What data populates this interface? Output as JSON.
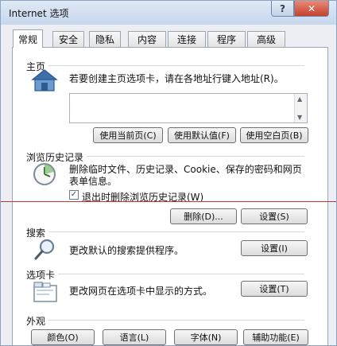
{
  "window": {
    "title": "Internet 选项",
    "help_label": "?",
    "close_label": "✕"
  },
  "tabs": [
    {
      "label": "常规",
      "active": true
    },
    {
      "label": "安全",
      "active": false
    },
    {
      "label": "隐私",
      "active": false
    },
    {
      "label": "内容",
      "active": false
    },
    {
      "label": "连接",
      "active": false
    },
    {
      "label": "程序",
      "active": false
    },
    {
      "label": "高级",
      "active": false
    }
  ],
  "home": {
    "group_label": "主页",
    "description": "若要创建主页选项卡，请在各地址行键入地址(R)。",
    "address_value": "",
    "use_current_label": "使用当前页(C)",
    "use_default_label": "使用默认值(F)",
    "use_blank_label": "使用空白页(B)"
  },
  "history": {
    "group_label": "浏览历史记录",
    "description_line1": "删除临时文件、历史记录、Cookie、保存的密码和网页",
    "description_line2": "表单信息。",
    "checkbox_label": "退出时删除浏览历史记录(W)",
    "checkbox_checked": true,
    "delete_label": "删除(D)...",
    "settings_label": "设置(S)"
  },
  "search": {
    "group_label": "搜索",
    "description": "更改默认的搜索提供程序。",
    "settings_label": "设置(I)"
  },
  "tabs_section": {
    "group_label": "选项卡",
    "description": "更改网页在选项卡中显示的方式。",
    "settings_label": "设置(T)"
  },
  "appearance": {
    "group_label": "外观",
    "colors_label": "颜色(O)",
    "languages_label": "语言(L)",
    "fonts_label": "字体(N)",
    "accessibility_label": "辅助功能(E)"
  }
}
